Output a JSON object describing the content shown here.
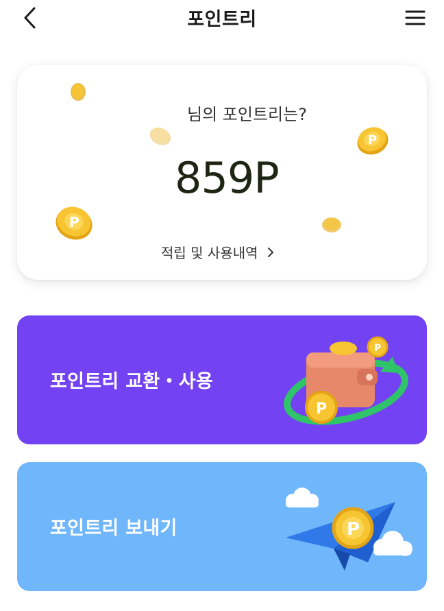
{
  "header": {
    "title": "포인트리",
    "back_icon": "chevron-left-icon",
    "menu_icon": "hamburger-menu-icon"
  },
  "points_card": {
    "greeting": "님의 포인트리는?",
    "points": "859P",
    "history_link": "적립 및 사용내역",
    "history_chevron": "chevron-right-icon"
  },
  "actions": [
    {
      "label": "포인트리 교환・사용",
      "icon": "wallet-exchange-icon",
      "color": "#7342f2"
    },
    {
      "label": "포인트리 보내기",
      "icon": "paper-plane-coin-icon",
      "color": "#6fb6fb"
    }
  ],
  "colors": {
    "coin": "#f7c531",
    "coin_dark": "#e3a516",
    "text_primary": "#1a1a1a",
    "points_text": "#1e2613"
  }
}
